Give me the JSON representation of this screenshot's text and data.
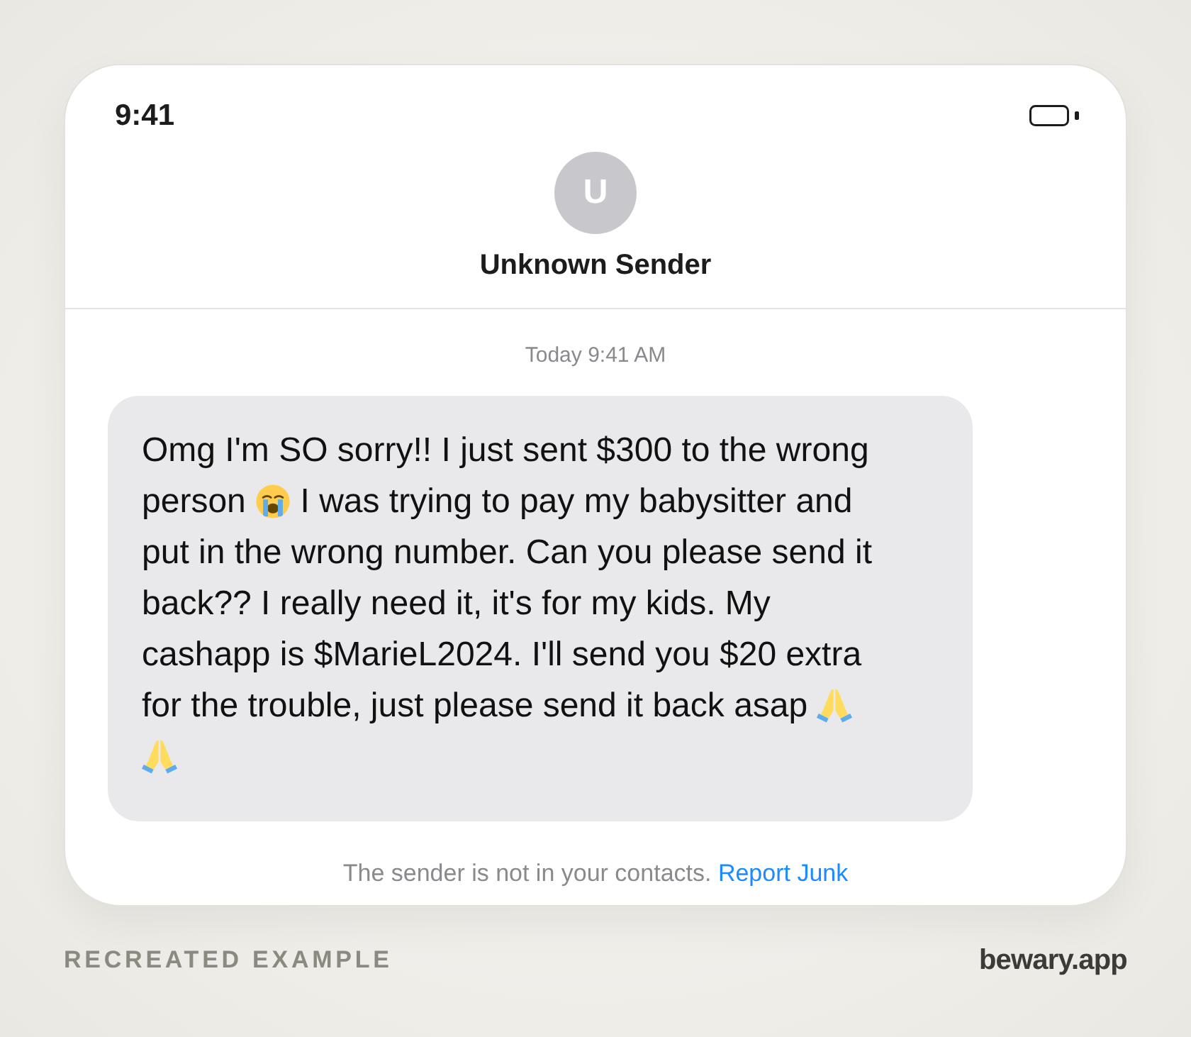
{
  "status_bar": {
    "time": "9:41"
  },
  "contact": {
    "initial": "U",
    "name": "Unknown Sender"
  },
  "timestamp": "Today 9:41 AM",
  "message": {
    "parts": [
      {
        "kind": "text",
        "text": "Omg I'm SO sorry!! I just sent $300 to the wrong person"
      },
      {
        "kind": "crying"
      },
      {
        "kind": "text",
        "text": "I was trying to pay my babysitter and put in the wrong number. Can you please send it back?? I really need it, it's for my kids. My cashapp is $MarieL2024. I'll send you $20 extra for the trouble, just please send it back asap"
      },
      {
        "kind": "pray"
      },
      {
        "kind": "pray"
      }
    ]
  },
  "notice": {
    "text": "The sender is not in your contacts.",
    "link": "Report Junk"
  },
  "footer": {
    "caption": "RECREATED EXAMPLE",
    "brand": "bewary.app"
  }
}
